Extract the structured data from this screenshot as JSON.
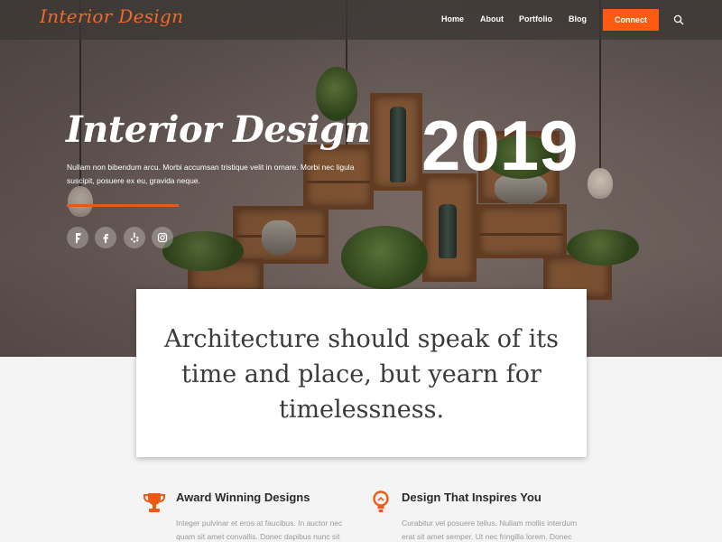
{
  "nav": {
    "logo": "Interior Design",
    "items": [
      "Home",
      "About",
      "Portfolio",
      "Blog"
    ],
    "connect": "Connect"
  },
  "hero": {
    "title": "Interior Design",
    "year": "2019",
    "description": "Nullam non bibendum arcu. Morbi accumsan tristique velit in ornare. Morbi nec ligula suscipit, posuere ex eu, gravida neque.",
    "social": [
      "foursquare-icon",
      "facebook-icon",
      "yelp-icon",
      "instagram-icon"
    ]
  },
  "quote": {
    "text": "Architecture should speak of its time and place, but yearn for timelessness."
  },
  "features": [
    {
      "title": "Award Winning Designs",
      "icon": "trophy-icon",
      "text": "Integer pulvinar et eros at faucibus. In auctor nec quam sit amet convallis. Donec dapibus nunc sit amet"
    },
    {
      "title": "Design That Inspires You",
      "icon": "lightbulb-icon",
      "text": "Curabitur vel posuere tellus. Nullam mollis interdum erat sit amet semper. Ut nec fringilla lorem. Donec ac"
    }
  ],
  "colors": {
    "accent": "#ff5a12",
    "logo": "#f06a2a"
  }
}
